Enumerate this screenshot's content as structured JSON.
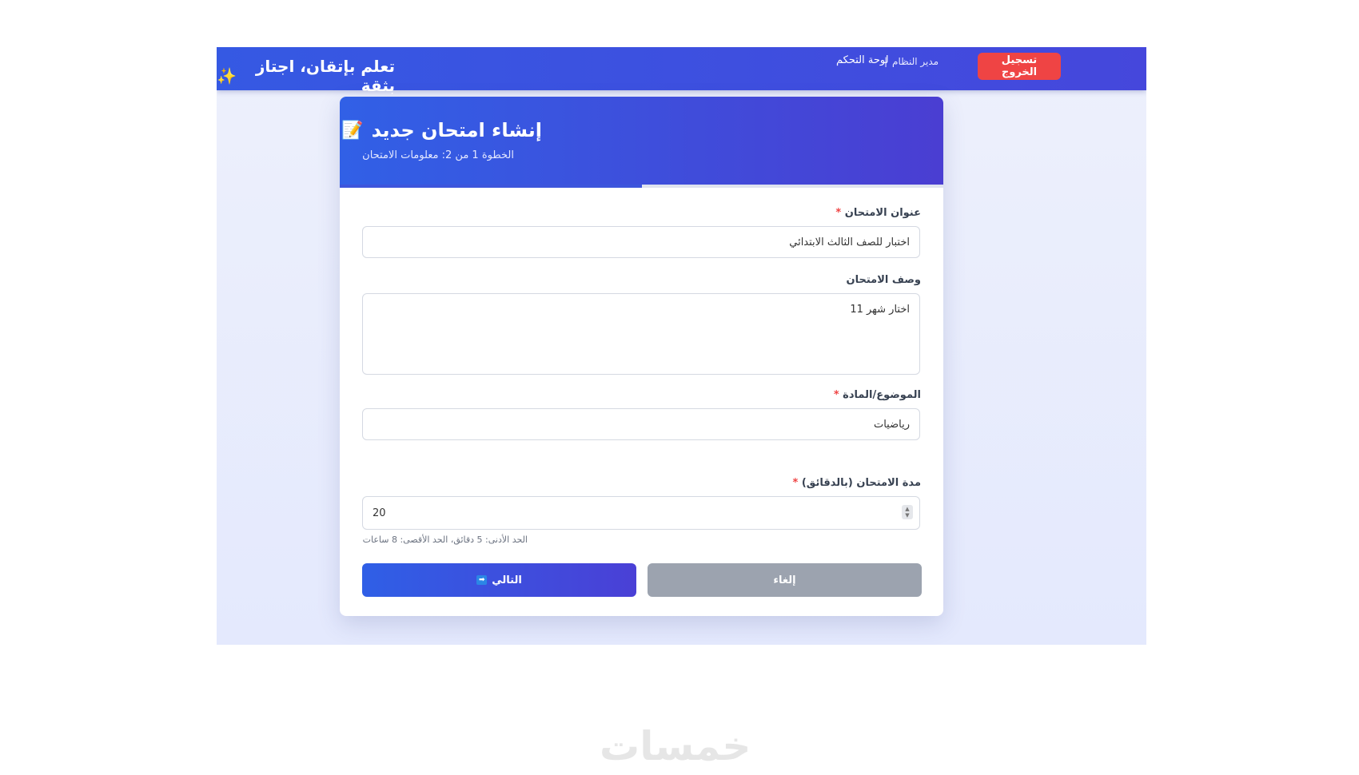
{
  "header": {
    "brand": "تعلم بإتقان، اجتاز بثقة",
    "brand_icon": "sparkle-icon",
    "logout_label": "تسجيل الخروج",
    "admin_label": "مدير النظام",
    "separator": "|",
    "dashboard_label": "لوحة التحكم"
  },
  "card": {
    "title": "إنشاء امتحان جديد",
    "title_icon": "📝",
    "subtitle": "الخطوة 1 من 2: معلومات الامتحان",
    "progress_fraction": 0.5
  },
  "form": {
    "title_label": "عنوان الامتحان",
    "title_value": "اختبار للصف الثالث الابتدائي",
    "description_label": "وصف الامتحان",
    "description_value": "اختار شهر 11",
    "subject_label": "الموضوع/المادة",
    "subject_value": "رياضيات",
    "duration_label": "مدة الامتحان (بالدقائق)",
    "duration_value": "20",
    "duration_hint": "الحد الأدنى: 5 دقائق، الحد الأقصى: 8 ساعات",
    "required_mark": "*"
  },
  "buttons": {
    "next_label": "التالي",
    "next_icon": "➡",
    "cancel_label": "إلغاء"
  },
  "watermark": "خمسات",
  "colors": {
    "accent": "#3559e3",
    "danger": "#ef4444",
    "muted": "#9ca3af"
  }
}
